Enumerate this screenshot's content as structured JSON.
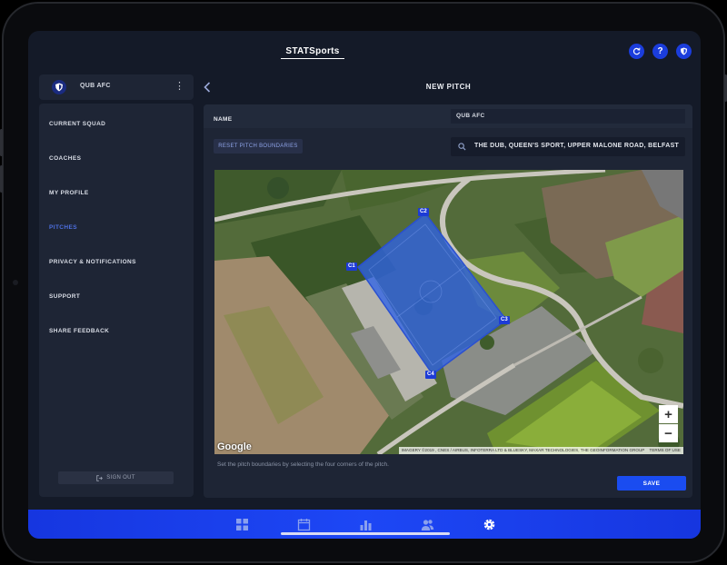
{
  "brand": {
    "logo_text": "STATSports"
  },
  "colors": {
    "accent": "#1d47f5",
    "active_menu": "#4d6fe0",
    "panel": "#1e2535",
    "pitch_overlay": "#2f63e6"
  },
  "header": {
    "icons": [
      "refresh-icon",
      "help-icon",
      "club-shield-icon"
    ]
  },
  "club": {
    "name": "QUB AFC",
    "menu_icon": "more-vertical-icon"
  },
  "sidebar": {
    "items": [
      {
        "label": "CURRENT SQUAD",
        "active": false
      },
      {
        "label": "COACHES",
        "active": false
      },
      {
        "label": "MY PROFILE",
        "active": false
      },
      {
        "label": "PITCHES",
        "active": true
      },
      {
        "label": "PRIVACY & NOTIFICATIONS",
        "active": false
      },
      {
        "label": "SUPPORT",
        "active": false
      },
      {
        "label": "SHARE FEEDBACK",
        "active": false
      }
    ],
    "sign_out_label": "SIGN OUT"
  },
  "page": {
    "title": "NEW PITCH"
  },
  "form": {
    "name_label": "NAME",
    "name_value": "QUB AFC",
    "reset_label": "RESET PITCH BOUNDARIES",
    "search_value": "THE DUB, QUEEN'S SPORT, UPPER MALONE ROAD, BELFAST"
  },
  "map": {
    "corners": [
      "C1",
      "C2",
      "C3",
      "C4"
    ],
    "google_label": "Google",
    "attribution": "IMAGERY ©2019 , CNES / AIRBUS, INFOTERRA LTD & BLUESKY, MAXAR TECHNOLOGIES, THE GEOINFORMATION GROUP",
    "terms_label": "TERMS OF USE",
    "zoom_in": "+",
    "zoom_out": "−"
  },
  "hint": "Set the pitch boundaries by selecting the four corners of the pitch.",
  "save_label": "SAVE",
  "tabbar": {
    "items": [
      {
        "icon": "dashboard-grid-icon",
        "active": false
      },
      {
        "icon": "calendar-icon",
        "active": false
      },
      {
        "icon": "bar-chart-icon",
        "active": false
      },
      {
        "icon": "team-icon",
        "active": false
      },
      {
        "icon": "settings-gear-icon",
        "active": true
      }
    ]
  }
}
